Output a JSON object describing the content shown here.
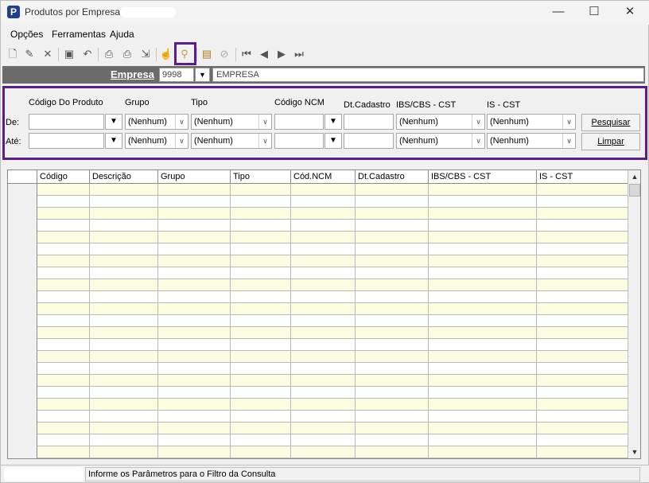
{
  "window": {
    "title": "Produtos por Empresa",
    "app_icon": "P",
    "minimize": "—",
    "maximize": "☐",
    "close": "✕"
  },
  "menu": [
    "Opções",
    "Ferramentas",
    "Ajuda"
  ],
  "toolbar": [
    "new-document-icon",
    "edit-icon",
    "delete-icon",
    "save-icon",
    "undo-icon",
    "print-icon",
    "print-preview-icon",
    "export-icon",
    "hand-icon",
    "search-icon",
    "properties-icon",
    "cancel-icon",
    "first-record-icon",
    "previous-record-icon",
    "next-record-icon",
    "last-record-icon"
  ],
  "empresa": {
    "label": "Empresa",
    "code": "9998",
    "name": "EMPRESA"
  },
  "filter": {
    "labels": {
      "codigo": "Código Do Produto",
      "grupo": "Grupo",
      "tipo": "Tipo",
      "ncm": "Código NCM",
      "dtcad": "Dt.Cadastro",
      "ibs": "IBS/CBS - CST",
      "is": "IS - CST"
    },
    "de_label": "De:",
    "ate_label": "Até:",
    "none_option": "(Nenhum)",
    "btn_search": "Pesquisar",
    "btn_clear": "Limpar"
  },
  "grid": {
    "columns": [
      "Código",
      "Descrição",
      "Grupo",
      "Tipo",
      "Cód.NCM",
      "Dt.Cadastro",
      "IBS/CBS - CST",
      "IS - CST"
    ],
    "row_count": 23
  },
  "status": {
    "message": "Informe os Parâmetros para o Filtro da Consulta"
  }
}
